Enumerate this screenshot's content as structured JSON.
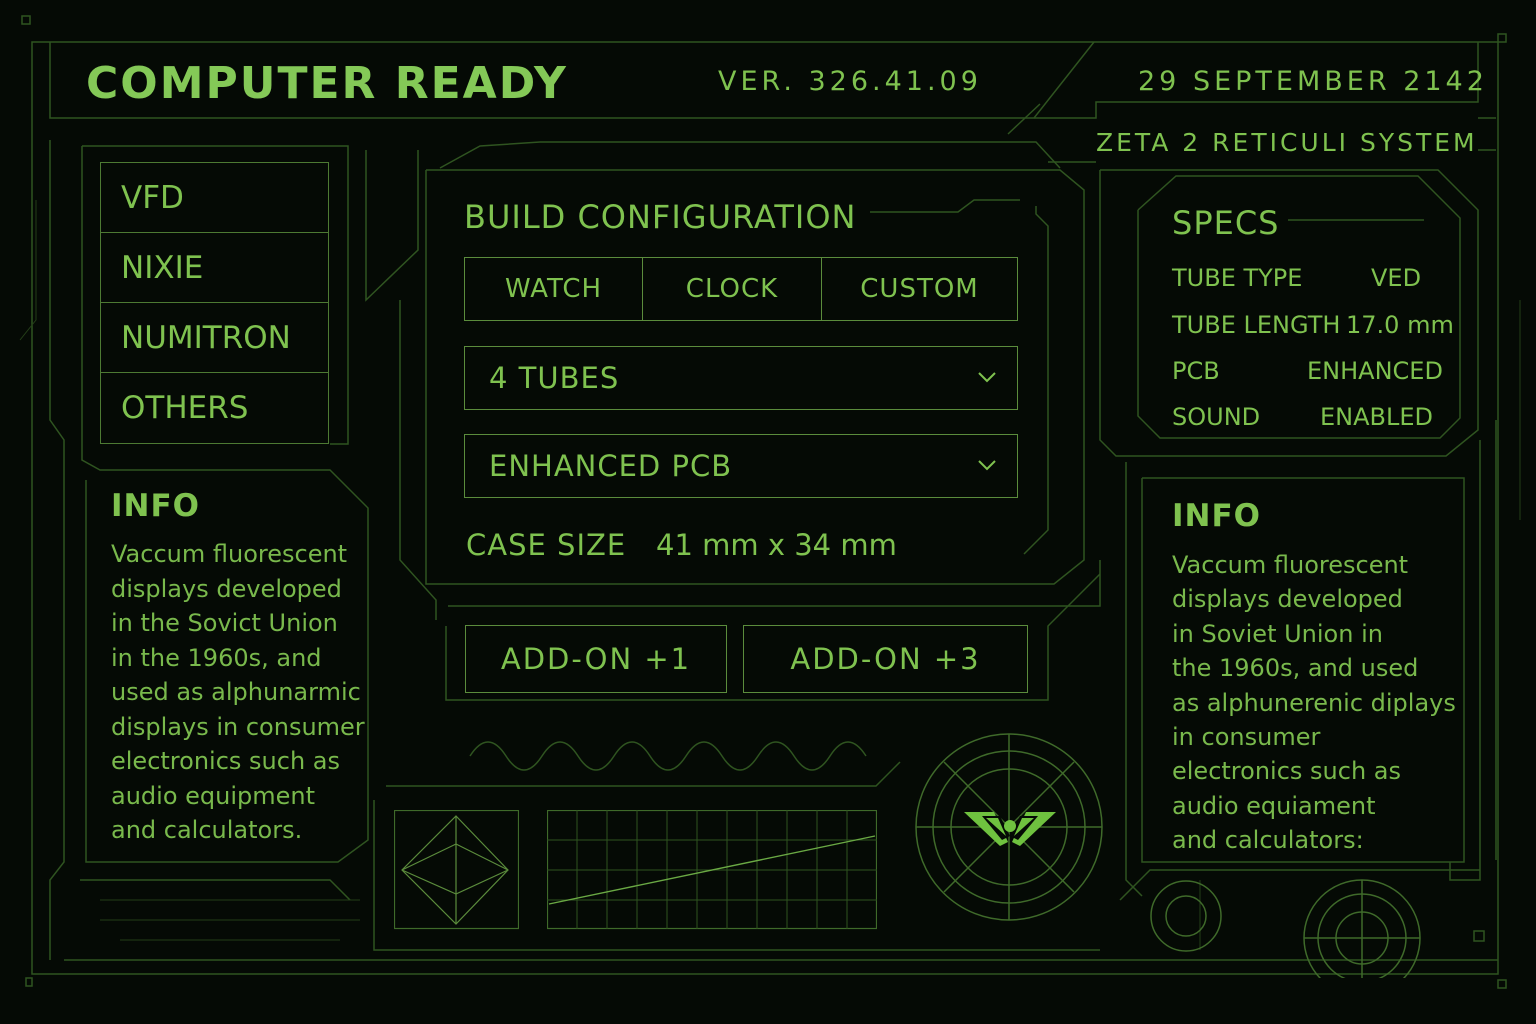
{
  "header": {
    "title": "COMPUTER READY",
    "version": "VER. 326.41.09",
    "date": "29 SEPTEMBER 2142",
    "system": "ZETA 2 RETICULI SYSTEM"
  },
  "tube_types": [
    {
      "label": "VFD"
    },
    {
      "label": "NIXIE"
    },
    {
      "label": "NUMITRON"
    },
    {
      "label": "OTHERS"
    }
  ],
  "info_left": {
    "heading": "INFO",
    "body": "Vaccum fluorescent\ndisplays developed\nin the Sovict Union\nin the 1960s, and\nused as alphunarmic\ndisplays in consumer\nelectronics such as\naudio equipment\nand calculators."
  },
  "build": {
    "title": "BUILD CONFIGURATION",
    "modes": [
      {
        "label": "WATCH"
      },
      {
        "label": "CLOCK"
      },
      {
        "label": "CUSTOM"
      }
    ],
    "tubes_select": "4 TUBES",
    "pcb_select": "ENHANCED PCB",
    "case_size_label": "CASE SIZE",
    "case_size_value": "41 mm x 34 mm"
  },
  "addons": [
    {
      "label": "ADD-ON +1"
    },
    {
      "label": "ADD-ON +3"
    }
  ],
  "specs": {
    "heading": "SPECS",
    "rows": [
      {
        "label": "TUBE TYPE",
        "value": "VED"
      },
      {
        "label": "TUBE LENGTH",
        "value": "17.0 mm"
      },
      {
        "label": "PCB",
        "value": "ENHANCED"
      },
      {
        "label": "SOUND",
        "value": "ENABLED"
      }
    ]
  },
  "info_right": {
    "heading": "INFO",
    "body": "Vaccum fluorescent\ndisplays developed\nin Soviet Union in\nthe 1960s, and used\nas alphunerenic diplays\nin consumer\nelectronics such as\naudio equiament\nand calculators:"
  },
  "colors": {
    "background": "#050a05",
    "text": "#7fc24f",
    "line": "#3f6a2a",
    "logo": "#6fc23f"
  },
  "icons": {
    "chevron": "chevron-down-icon",
    "logo": "winged-logo-icon",
    "octahedron": "octahedron-icon",
    "target": "target-ring-icon"
  }
}
